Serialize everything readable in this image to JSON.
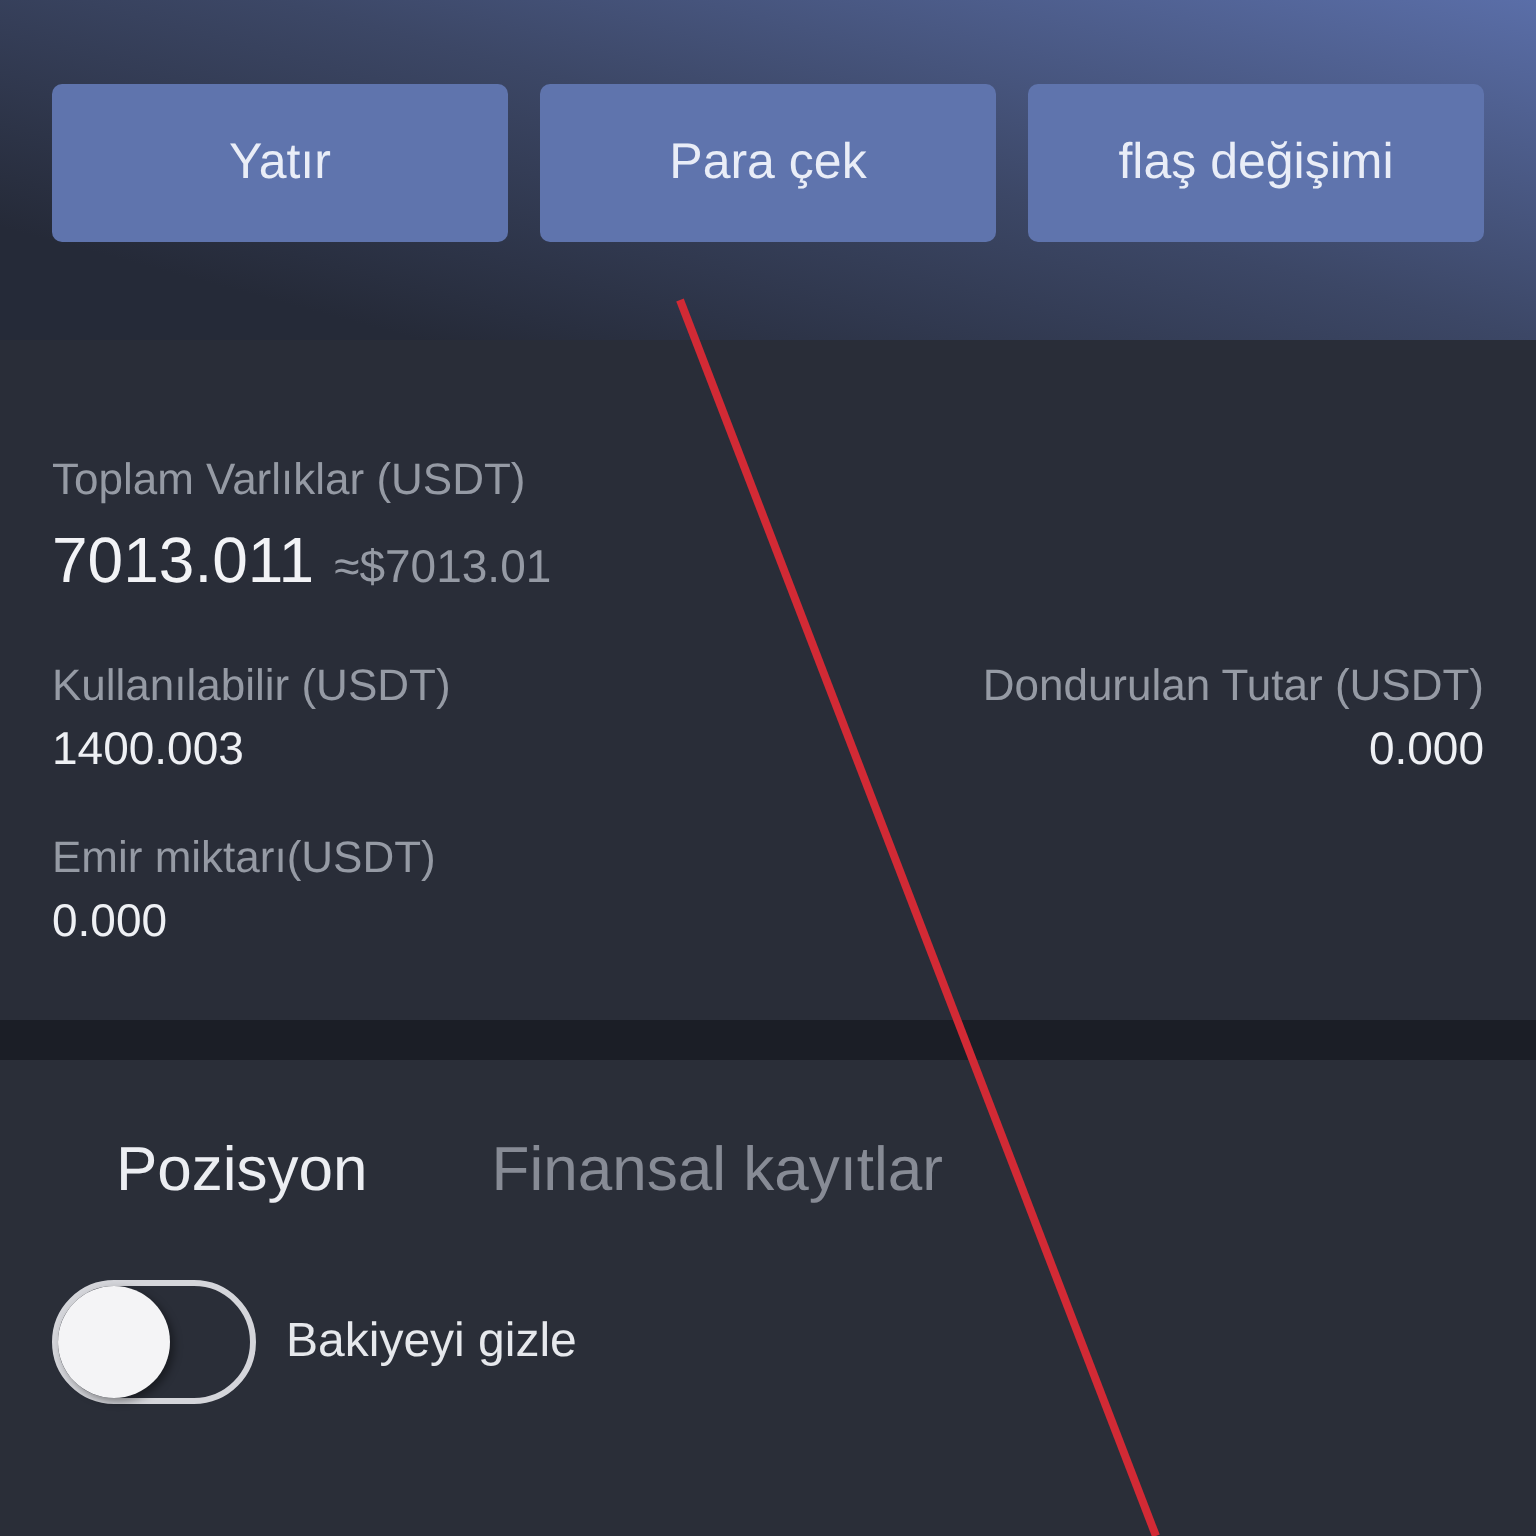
{
  "header": {
    "buttons": [
      {
        "label": "Yatır"
      },
      {
        "label": "Para çek"
      },
      {
        "label": "flaş değişimi"
      }
    ]
  },
  "assets": {
    "total": {
      "label": "Toplam Varlıklar (USDT)",
      "value": "7013.011",
      "equivalent": "≈$7013.01"
    },
    "rows": [
      {
        "left": {
          "label": "Kullanılabilir (USDT)",
          "value": "1400.003"
        },
        "right": {
          "label": "Dondurulan Tutar (USDT)",
          "value": "0.000"
        }
      },
      {
        "left": {
          "label": "Emir miktarı(USDT)",
          "value": "0.000"
        }
      }
    ]
  },
  "tabs": [
    {
      "label": "Pozisyon",
      "selected": true
    },
    {
      "label": "Finansal kayıtlar",
      "selected": false
    }
  ],
  "hide_balance": {
    "label": "Bakiyeyi gizle",
    "on": false
  }
}
